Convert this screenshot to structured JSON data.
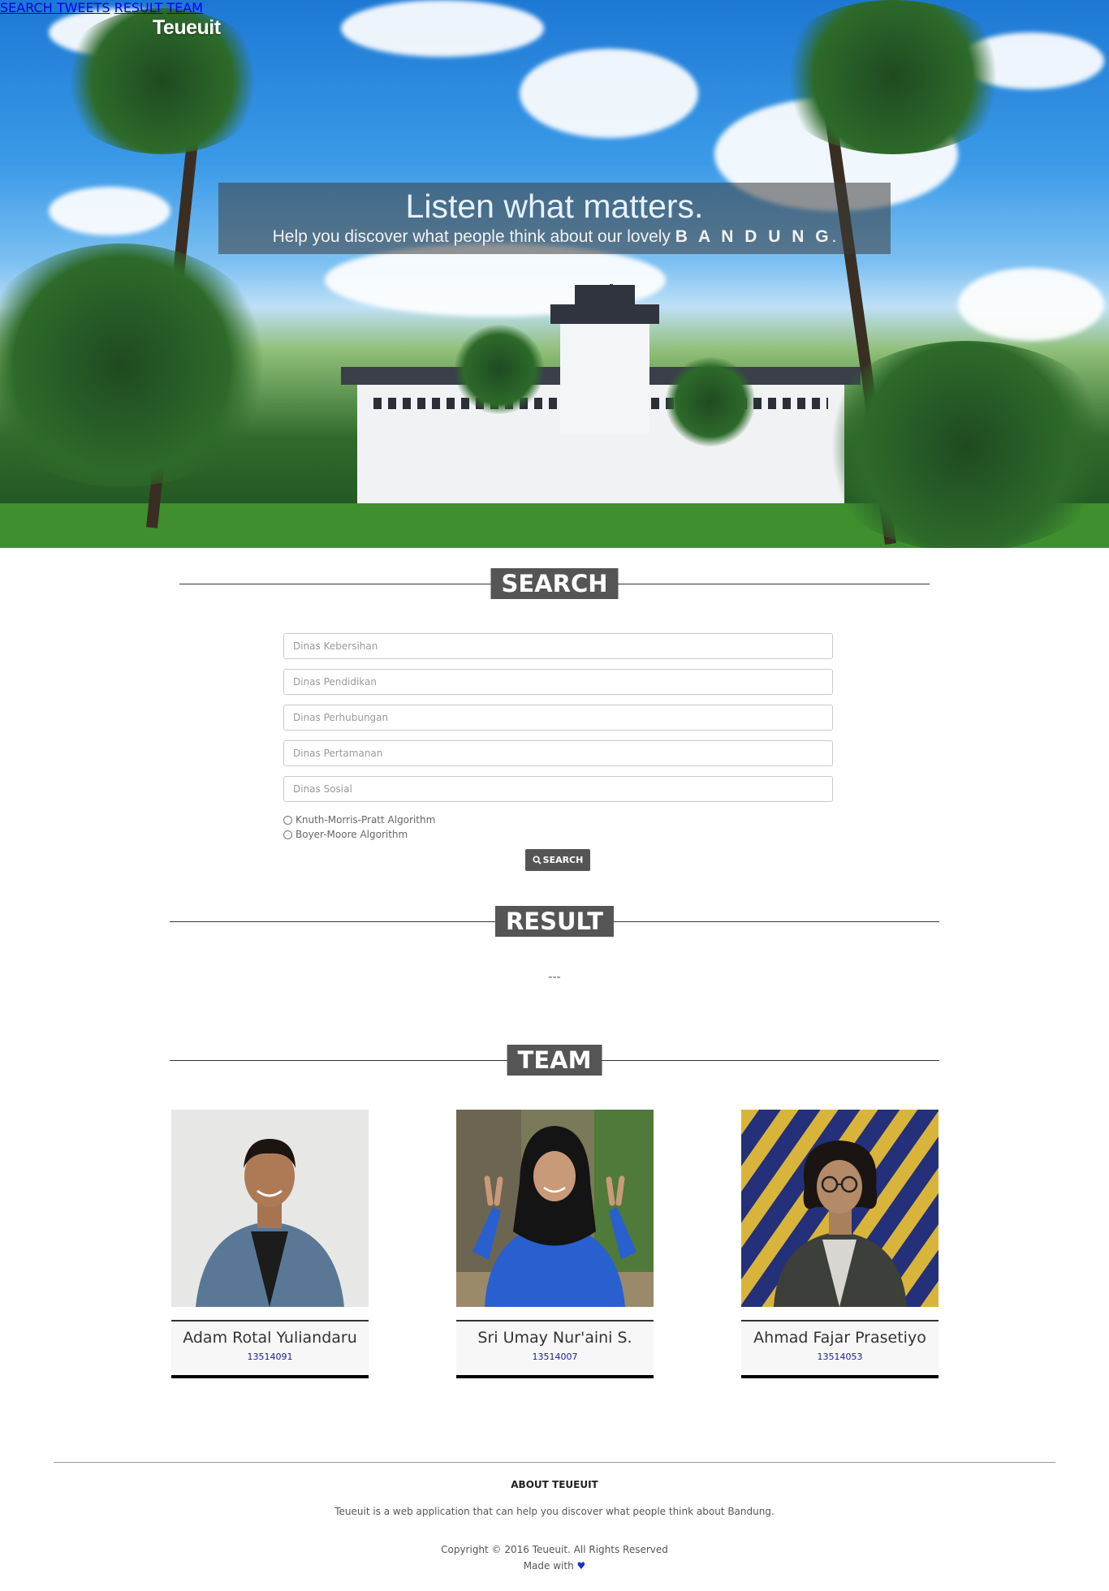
{
  "brand": "Teueuit",
  "nav": {
    "search": "SEARCH TWEETS",
    "result": "RESULT",
    "team": "TEAM"
  },
  "hero": {
    "title": "Listen what matters.",
    "subtitle_prefix": "Help you discover what people think about our lovely ",
    "subtitle_emphasis": "BANDUNG",
    "subtitle_suffix": "."
  },
  "search": {
    "heading": "SEARCH",
    "fields": [
      {
        "placeholder": "Dinas Kebersihan"
      },
      {
        "placeholder": "Dinas Pendidikan"
      },
      {
        "placeholder": "Dinas Perhubungan"
      },
      {
        "placeholder": "Dinas Pertamanan"
      },
      {
        "placeholder": "Dinas Sosial"
      }
    ],
    "algorithms": [
      "Knuth-Morris-Pratt Algorithm",
      "Boyer-Moore Algorithm"
    ],
    "button_label": "SEARCH",
    "button_icon": "search-icon"
  },
  "result": {
    "heading": "RESULT",
    "placeholder": "---"
  },
  "team": {
    "heading": "TEAM",
    "members": [
      {
        "name": "Adam Rotal Yuliandaru",
        "nim": "13514091"
      },
      {
        "name": "Sri Umay Nur'aini S.",
        "nim": "13514007"
      },
      {
        "name": "Ahmad Fajar Prasetiyo",
        "nim": "13514053"
      }
    ]
  },
  "footer": {
    "title": "ABOUT TEUEUIT",
    "description": "Teueuit is a web application that can help you discover what people think about Bandung.",
    "copyright": "Copyright © 2016 Teueuit. All Rights Reserved",
    "made_with": "Made with",
    "heart": "♥"
  },
  "colors": {
    "accent": "#555555",
    "heart": "#1a2fd0",
    "nim": "#1a1a9a"
  }
}
